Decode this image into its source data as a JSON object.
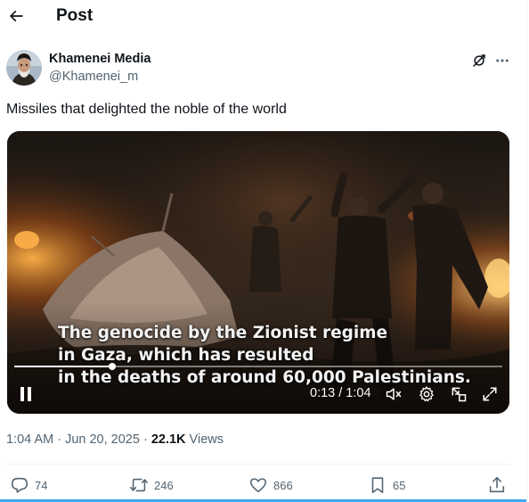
{
  "header": {
    "title": "Post",
    "back_icon": "arrow-left-icon"
  },
  "author": {
    "name": "Khamenei Media",
    "handle": "@Khamenei_m"
  },
  "post": {
    "text": "Missiles that delighted the noble of the world"
  },
  "video": {
    "subtitle_lines": [
      "The genocide by the Zionist regime",
      "in Gaza, which has resulted",
      "in the deaths of around 60,000 Palestinians."
    ],
    "time": "0:13 / 1:04",
    "progress": 0.2
  },
  "meta": {
    "timestamp": "1:04 AM · Jun 20, 2025 · ",
    "views_count": "22.1K",
    "views_label": " Views"
  },
  "actions": {
    "replies": "74",
    "reposts": "246",
    "likes": "866",
    "bookmarks": "65"
  },
  "colors": {
    "text": "#0f1419",
    "secondary": "#536471",
    "accent": "#1d9bf0",
    "divider": "#eff3f4"
  }
}
